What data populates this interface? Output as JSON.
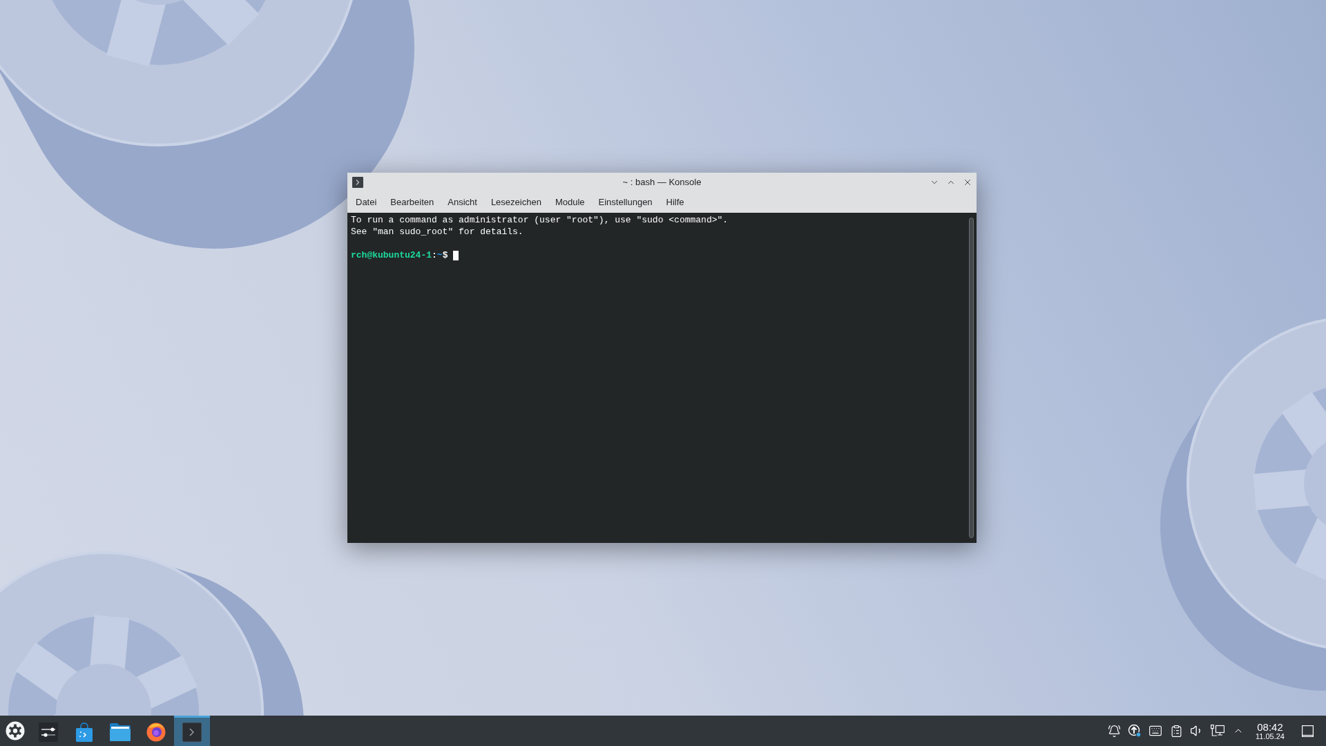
{
  "window": {
    "title": "~ : bash — Konsole"
  },
  "menu": [
    "Datei",
    "Bearbeiten",
    "Ansicht",
    "Lesezeichen",
    "Module",
    "Einstellungen",
    "Hilfe"
  ],
  "terminal": {
    "lines": [
      {
        "kind": "output",
        "text": "To run a command as administrator (user \"root\"), use \"sudo <command>\"."
      },
      {
        "kind": "output",
        "text": "See \"man sudo_root\" for details."
      },
      {
        "kind": "blank"
      },
      {
        "kind": "prompt",
        "user_host": "rch@kubuntu24-1",
        "separator": ":",
        "path": "~",
        "symbol": "$"
      }
    ]
  },
  "taskbar": {
    "tasks": [
      {
        "active": false
      },
      {
        "active": false
      },
      {
        "active": false
      },
      {
        "active": false
      },
      {
        "active": true
      }
    ],
    "clock": {
      "time": "08:42",
      "date": "11.05.24"
    }
  }
}
